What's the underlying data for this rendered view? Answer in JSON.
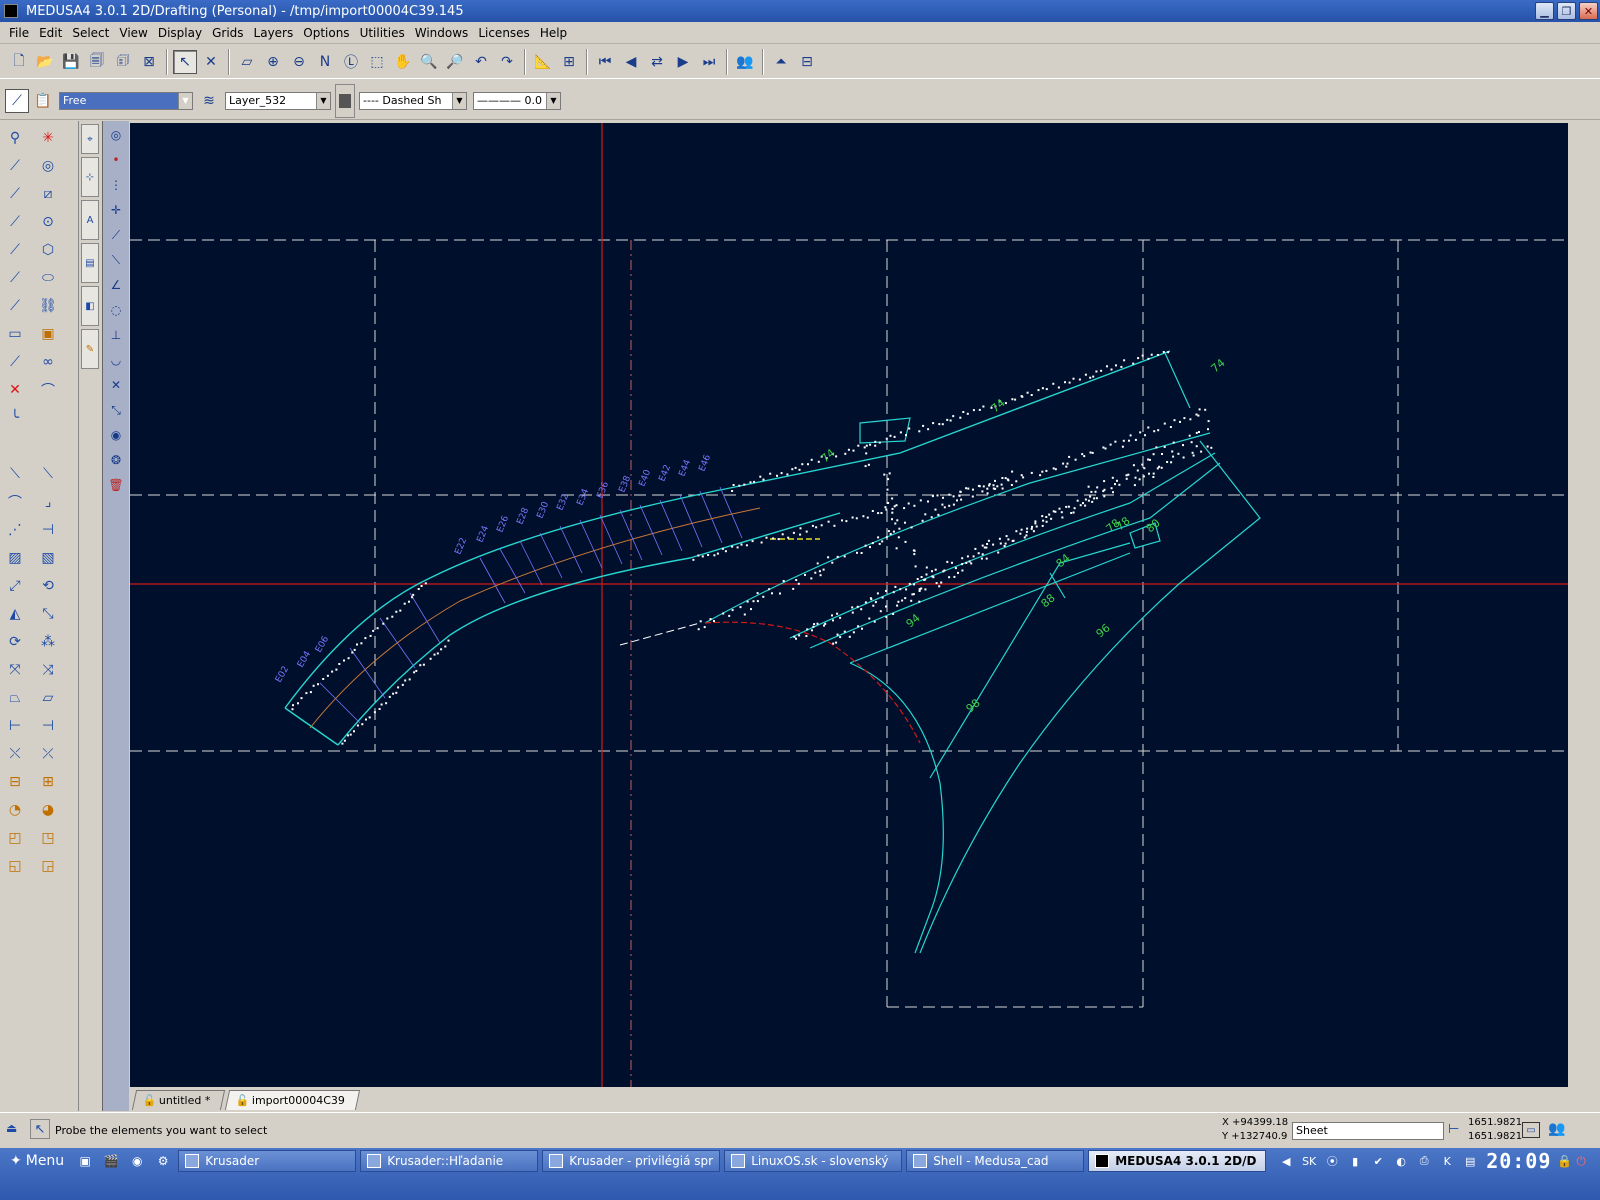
{
  "window": {
    "title": "MEDUSA4 3.0.1 2D/Drafting (Personal) - /tmp/import00004C39.145",
    "minimize": "▁",
    "restore": "❐",
    "close": "✕"
  },
  "menubar": [
    "File",
    "Edit",
    "Select",
    "View",
    "Display",
    "Grids",
    "Layers",
    "Options",
    "Utilities",
    "Windows",
    "Licenses",
    "Help"
  ],
  "toolbar": {
    "items": [
      {
        "name": "new-file-icon",
        "glyph": "🗋"
      },
      {
        "name": "open-folder-icon",
        "glyph": "📂"
      },
      {
        "name": "save-icon",
        "glyph": "💾"
      },
      {
        "name": "save-as-icon",
        "glyph": "🗐"
      },
      {
        "name": "save-all-icon",
        "glyph": "🗊"
      },
      {
        "name": "close-file-icon",
        "glyph": "⊠"
      },
      {
        "name": "sep"
      },
      {
        "name": "select-arrow-icon",
        "glyph": "↖",
        "selected": true
      },
      {
        "name": "cancel-icon",
        "glyph": "✕"
      },
      {
        "name": "sep"
      },
      {
        "name": "redraw-icon",
        "glyph": "▱"
      },
      {
        "name": "zoom-in-icon",
        "glyph": "⊕"
      },
      {
        "name": "zoom-out-icon",
        "glyph": "⊖"
      },
      {
        "name": "zoom-name-icon",
        "glyph": "N"
      },
      {
        "name": "zoom-limits-icon",
        "glyph": "Ⓛ"
      },
      {
        "name": "zoom-window-icon",
        "glyph": "⬚"
      },
      {
        "name": "pan-hand-icon",
        "glyph": "✋"
      },
      {
        "name": "zoom-plus-icon",
        "glyph": "🔍"
      },
      {
        "name": "zoom-minus-icon",
        "glyph": "🔎"
      },
      {
        "name": "undo-icon",
        "glyph": "↶"
      },
      {
        "name": "redo-icon",
        "glyph": "↷"
      },
      {
        "name": "sep"
      },
      {
        "name": "ruler-icon",
        "glyph": "📐"
      },
      {
        "name": "scale-1to1-icon",
        "glyph": "⊞"
      },
      {
        "name": "sep"
      },
      {
        "name": "first-sheet-icon",
        "glyph": "⏮"
      },
      {
        "name": "prev-sheet-icon",
        "glyph": "◀"
      },
      {
        "name": "swap-sheet-icon",
        "glyph": "⇄"
      },
      {
        "name": "next-sheet-icon",
        "glyph": "▶"
      },
      {
        "name": "last-sheet-icon",
        "glyph": "⏭"
      },
      {
        "name": "sep"
      },
      {
        "name": "users-icon",
        "glyph": "👥"
      },
      {
        "name": "sep"
      },
      {
        "name": "window-up-icon",
        "glyph": "⏶"
      },
      {
        "name": "window-tile-icon",
        "glyph": "⊟"
      }
    ]
  },
  "attributes": {
    "style_mode": "Free",
    "layer": "Layer_532",
    "linetype": "----   Dashed Sh",
    "linewidth": "———— 0.0"
  },
  "drawing": {
    "station_labels": [
      "E22",
      "E24",
      "E26",
      "E28",
      "E30",
      "E32",
      "E34",
      "E36",
      "E38",
      "E40",
      "E42",
      "E44",
      "E46"
    ],
    "left_labels": [
      "E02",
      "E04",
      "E06"
    ],
    "profile_labels": [
      "74",
      "78",
      "80",
      "84",
      "88",
      "94",
      "96",
      "98",
      "78",
      "74",
      "74"
    ]
  },
  "tabs": [
    "untitled *",
    "import00004C39"
  ],
  "status": {
    "prompt": "Probe the elements you want to select",
    "x": "X +94399.18",
    "y": "Y +132740.9",
    "sheet": "Sheet",
    "scale1": "1651.9821",
    "scale2": "1651.9821"
  },
  "taskbar": {
    "start": "Menu",
    "tasks": [
      {
        "label": "Krusader",
        "active": false
      },
      {
        "label": "Krusader::Hľadanie",
        "active": false
      },
      {
        "label": "Krusader - privilégiá spr",
        "active": false
      },
      {
        "label": "LinuxOS.sk - slovenský",
        "active": false
      },
      {
        "label": "Shell - Medusa_cad",
        "active": false
      },
      {
        "label": "MEDUSA4 3.0.1 2D/D",
        "active": true
      }
    ],
    "clock": "20:09"
  },
  "colors": {
    "canvas_bg": "#00102c",
    "cyan": "#27d6d0",
    "white_points": "#ffffff",
    "label_blue": "#7a74ff",
    "label_green": "#3fd14a",
    "crosshair_red": "#d01818",
    "orange_line": "#c8783a"
  }
}
